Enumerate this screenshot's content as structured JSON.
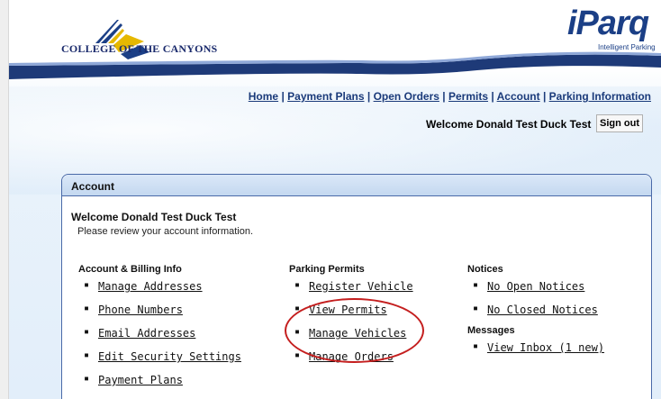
{
  "brand": {
    "college_name": "COLLEGE OF THE CANYONS",
    "iparq_logo": "iParq",
    "iparq_tagline": "Intelligent Parking"
  },
  "nav": {
    "items": [
      "Home",
      "Payment Plans",
      "Open Orders",
      "Permits",
      "Account",
      "Parking Information"
    ],
    "separator": "|"
  },
  "header": {
    "welcome": "Welcome Donald Test Duck Test",
    "signout_label": "Sign out"
  },
  "panel": {
    "title": "Account",
    "welcome": "Welcome Donald Test Duck Test",
    "subtitle": "Please review your account information."
  },
  "columns": {
    "billing": {
      "heading": "Account & Billing Info",
      "links": [
        "Manage Addresses",
        "Phone Numbers",
        "Email Addresses",
        "Edit Security Settings",
        "Payment Plans"
      ]
    },
    "permits": {
      "heading": "Parking Permits",
      "links": [
        "Register Vehicle",
        "View Permits",
        "Manage Vehicles",
        "Manage Orders"
      ]
    },
    "notices": {
      "heading": "Notices",
      "links": [
        "No Open Notices",
        "No Closed Notices"
      ]
    },
    "messages": {
      "heading": "Messages",
      "links": [
        "View Inbox (1 new)"
      ]
    }
  },
  "colors": {
    "navy": "#1b3f86",
    "gold": "#e6b800",
    "annotation": "#c41e1e"
  }
}
